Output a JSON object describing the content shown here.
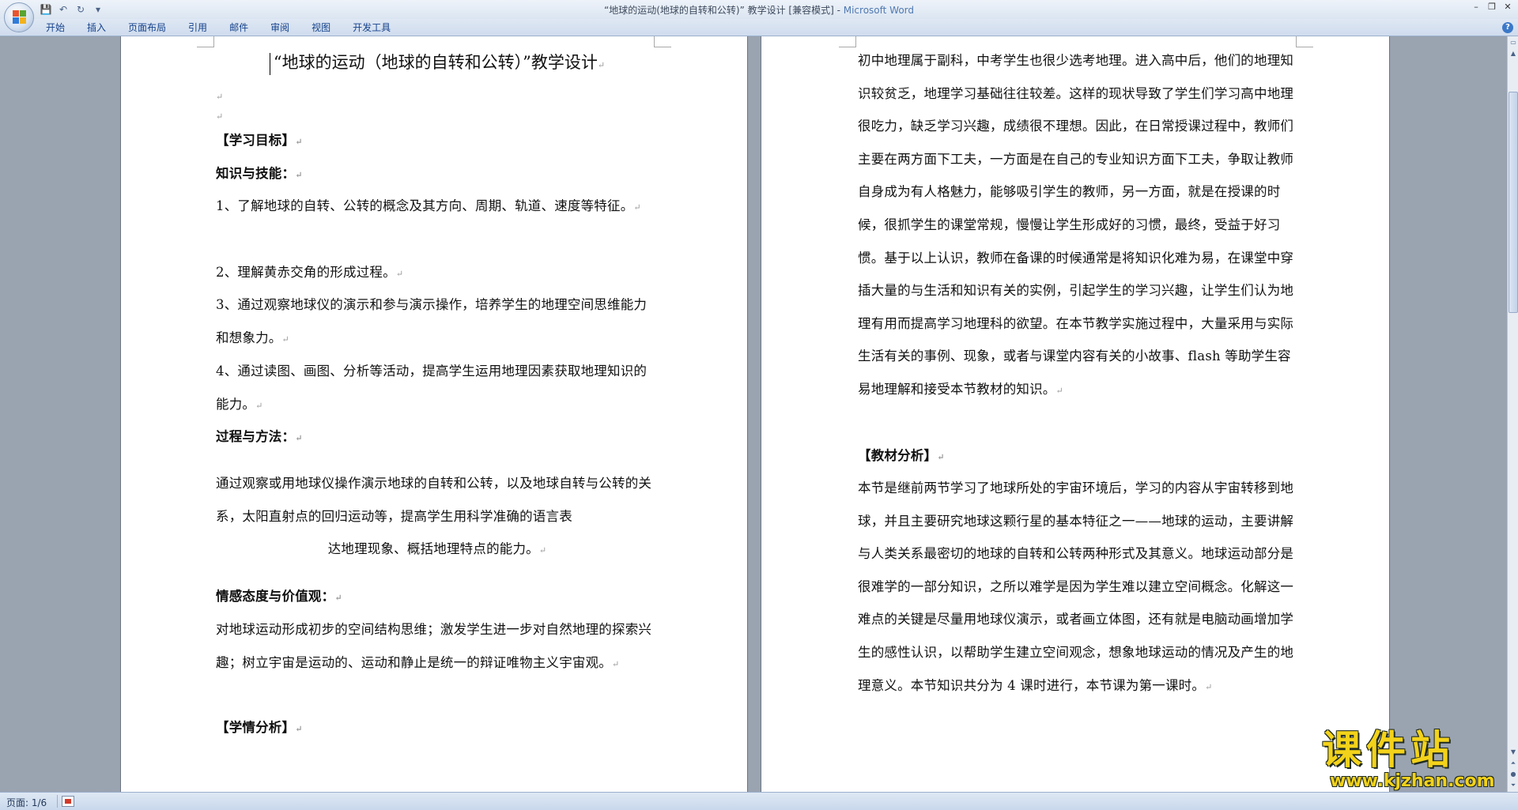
{
  "window": {
    "title": "“地球的运动(地球的自转和公转)” 教学设计 [兼容模式] - ",
    "app_name": "Microsoft Word"
  },
  "qat": {
    "save_icon": "💾",
    "undo_icon": "↶",
    "redo_icon": "↻",
    "customize_icon": "▾"
  },
  "ribbon": {
    "tabs": [
      "开始",
      "插入",
      "页面布局",
      "引用",
      "邮件",
      "审阅",
      "视图",
      "开发工具"
    ]
  },
  "document": {
    "left_page": {
      "title": "“地球的运动（地球的自转和公转）”教学设计",
      "heading_objectives": "【学习目标】",
      "sub_knowledge": "知识与技能：",
      "item1": "  1、了解地球的自转、公转的概念及其方向、周期、轨道、速度等特征。",
      "item2": "  2、理解黄赤交角的形成过程。",
      "item3": "3、通过观察地球仪的演示和参与演示操作，培养学生的地理空间思维能力和想象力。",
      "item4": "4、通过读图、画图、分析等活动，提高学生运用地理因素获取地理知识的能力。",
      "sub_process": "过程与方法：",
      "process_text_a": "通过观察或用地球仪操作演示地球的自转和公转，以及地球自转与公转的关系，太阳直射点的回归运动等，提高学生用科学准确的语言表",
      "process_text_b": "达地理现象、概括地理特点的能力。",
      "sub_emotion": "情感态度与价值观：",
      "emotion_text": "对地球运动形成初步的空间结构思维；激发学生进一步对自然地理的探索兴趣；树立宇宙是运动的、运动和静止是统一的辩证唯物主义宇宙观。",
      "heading_analysis": "【学情分析】"
    },
    "right_page": {
      "para1": "初中地理属于副科，中考学生也很少选考地理。进入高中后，他们的地理知识较贫乏，地理学习基础往往较差。这样的现状导致了学生们学习高中地理很吃力，缺乏学习兴趣，成绩很不理想。因此，在日常授课过程中，教师们主要在两方面下工夫，一方面是在自己的专业知识方面下工夫，争取让教师自身成为有人格魅力，能够吸引学生的教师，另一方面，就是在授课的时候，很抓学生的课堂常规，慢慢让学生形成好的习惯，最终，受益于好习惯。基于以上认识，教师在备课的时候通常是将知识化难为易，在课堂中穿插大量的与生活和知识有关的实例，引起学生的学习兴趣，让学生们认为地理有用而提高学习地理科的欲望。在本节教学实施过程中，大量采用与实际生活有关的事例、现象，或者与课堂内容有关的小故事、flash 等助学生容易地理解和接受本节教材的知识。",
      "heading_material": "【教材分析】",
      "para2": "本节是继前两节学习了地球所处的宇宙环境后，学习的内容从宇宙转移到地球，并且主要研究地球这颗行星的基本特征之一——地球的运动，主要讲解与人类关系最密切的地球的自转和公转两种形式及其意义。地球运动部分是很难学的一部分知识，之所以难学是因为学生难以建立空间概念。化解这一难点的关键是尽量用地球仪演示，或者画立体图，还有就是电脑动画增加学生的感性认识，以帮助学生建立空间观念，想象地球运动的情况及产生的地理意义。本节知识共分为 4 课时进行，本节课为第一课时。"
    }
  },
  "status": {
    "page": "页面: 1/6"
  },
  "watermark": {
    "cn": "课件站",
    "url": "www.kjzhan.com"
  },
  "colors": {
    "accent": "#15428b",
    "brand": "#4f79b2",
    "watermark": "#f3d21a"
  }
}
